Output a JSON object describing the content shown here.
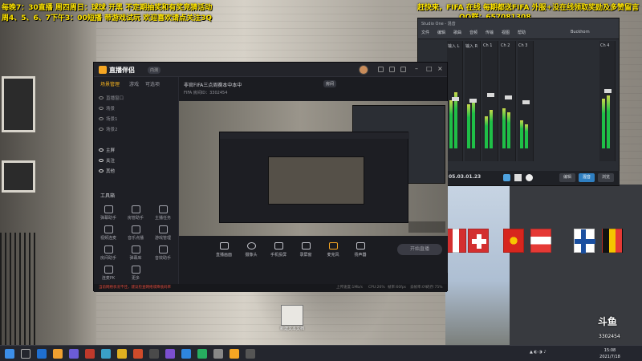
{
  "overlay": {
    "line1": "每晚7：30直播   周四周日：球球   开黑   不定期抽奖和有奖竞猜活动",
    "line2": "周4、5、6、7下午3：00短播 带游戏试玩   欢迎喜欢请点关注3Q",
    "right_line1": "赶快来，FIFA 在线 每期都送FIFA 外服+没在线领取奖励及多赞留言",
    "right_line2": "QQ群：657081308"
  },
  "live_app": {
    "name": "直播伴侣",
    "badge": "内测",
    "left_tabs": [
      "场景管理",
      "游戏",
      "可选项"
    ],
    "scenes": [
      "直播窗口",
      "场景",
      "场景1",
      "场景2",
      "主屏",
      "关注",
      "其他"
    ],
    "tools_title": "工具箱",
    "tools": [
      "弹幕助手",
      "房管助手",
      "主播任务",
      "视频连麦",
      "音乐点播",
      "游戏管理",
      "房间助手",
      "弹幕库",
      "音效助手",
      "连麦PK",
      "更多"
    ],
    "room_title": "非官FIFA三点周赛本中本中",
    "room_sub": "FIFA 房间ID：3302454",
    "room_tag": "房间",
    "bottom": [
      "直播画面",
      "摄像头",
      "手机投屏",
      "录屏窗",
      "麦克风",
      "扬声器"
    ],
    "start_label": "开始直播",
    "warning": "当前网络状况不佳，建议检查网络或降低码率",
    "stats": [
      "上传速度:1Mb/s",
      "CPU:26%",
      "帧率:60fps",
      "丢帧率:0%",
      "内存:75%"
    ]
  },
  "daw": {
    "title": "Studio One - 混音",
    "menus": [
      "文件",
      "编辑",
      "歌曲",
      "音频",
      "传输",
      "视图",
      "帮助",
      "Buckhorn"
    ],
    "channels": [
      "输入 L",
      "输入 R",
      "Ch 1",
      "Ch 2",
      "Ch 3",
      "Ch 4"
    ],
    "timecode": "05.03.01.23",
    "tabs": [
      "编辑",
      "混音",
      "浏览"
    ]
  },
  "desktop_icon_label": "新建文本文档",
  "watermark": {
    "logo": "斗鱼",
    "room_id": "3302454"
  },
  "taskbar": {
    "time": "15:08",
    "date": "2021/7/18"
  }
}
